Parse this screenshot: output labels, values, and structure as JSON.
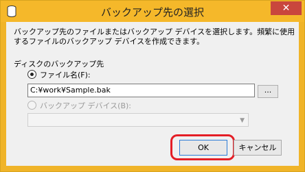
{
  "window": {
    "title": "バックアップ先の選択",
    "close_label": "✕",
    "icon": "database-icon"
  },
  "dialog": {
    "description": "バックアップ先のファイルまたはバックアップ デバイスを選択します。頻繁に使用するファイルのバックアップ デバイスを作成できます。",
    "section_label": "ディスクのバックアップ先",
    "file_radio_label": "ファイル名(F):",
    "file_radio_checked": true,
    "file_path": "C:¥work¥Sample.bak",
    "browse_label": "...",
    "device_radio_label": "バックアップ デバイス(B):",
    "device_radio_enabled": false,
    "device_select_value": ""
  },
  "buttons": {
    "ok_label": "OK",
    "cancel_label": "キャンセル"
  },
  "colors": {
    "title_bar": "#f5b82a",
    "highlight": "#e41e26",
    "default_button_border": "#2b7bd6"
  }
}
